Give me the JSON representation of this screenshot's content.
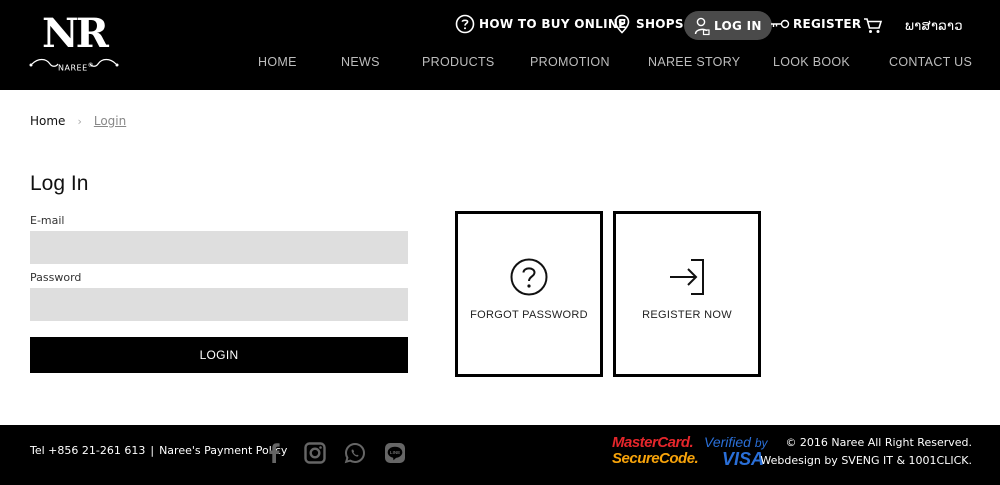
{
  "logo": {
    "letters": "NR",
    "sub": "NAREE",
    "sub_mark": "®"
  },
  "topbar": {
    "how_to_buy": "HOW TO BUY ONLINE",
    "shops": "SHOPS",
    "login": "LOG IN",
    "register": "REGISTER",
    "language": "ພາສາລາວ"
  },
  "nav": {
    "items": [
      "HOME",
      "NEWS",
      "PRODUCTS",
      "PROMOTION",
      "NAREE STORY",
      "LOOK BOOK",
      "CONTACT US"
    ]
  },
  "breadcrumb": {
    "home": "Home",
    "separator": "›",
    "current": "Login"
  },
  "form": {
    "title": "Log In",
    "email_label": "E-mail",
    "email_value": "",
    "password_label": "Password",
    "password_value": "",
    "submit_label": "LOGIN"
  },
  "tiles": {
    "forgot": {
      "label": "FORGOT PASSWORD",
      "icon": "question-circle-icon"
    },
    "register": {
      "label": "REGISTER NOW",
      "icon": "sign-in-arrow-icon"
    }
  },
  "footer": {
    "phone": "Tel +856 21-261 613",
    "separator": "|",
    "payment_policy": "Naree's Payment Policy",
    "social_icons": [
      "facebook-icon",
      "instagram-icon",
      "whatsapp-icon",
      "line-icon"
    ],
    "mastercard_line1": "MasterCard.",
    "mastercard_line2": "SecureCode.",
    "visa_line1": "Verified",
    "visa_by": "by",
    "visa_line2": "VISA",
    "copyright": "© 2016 Naree All Right Reserved.",
    "credits": "Webdesign by SVENG IT & 1001CLICK."
  },
  "colors": {
    "header_bg": "#000000",
    "login_pill": "#4a4a4a",
    "input_bg": "#dedede",
    "mastercard_red": "#e4262b",
    "mastercard_orange": "#f7a30a",
    "visa_blue": "#2a6fd8"
  }
}
